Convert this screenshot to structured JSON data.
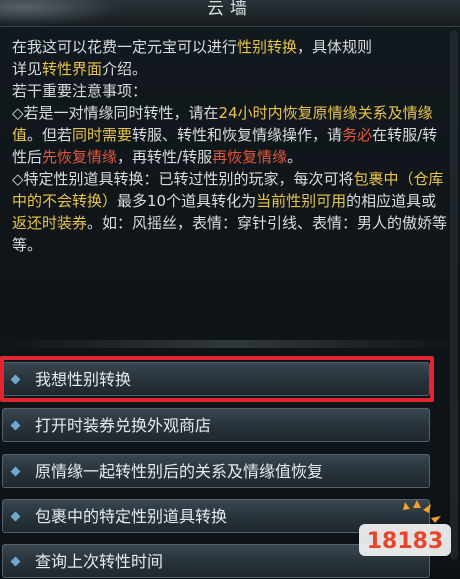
{
  "window": {
    "title": "云墙"
  },
  "content": {
    "line_intro_a": "在我这可以花费一定元宝可以进行",
    "line_intro_hl": "性别转换",
    "line_intro_b": "，具体规则",
    "line_intro2_a": "详见",
    "line_intro2_hl": "转性界面",
    "line_intro2_b": "介绍。",
    "notice_heading": "若干重要注意事项：",
    "p1_a": "◇若是一对情缘同时转性，请在",
    "p1_hl1": "24小时内恢复原情缘关系及情缘值",
    "p1_b": "。但若",
    "p1_hl2": "同时需要",
    "p1_c": "转服、转性和恢复情缘操作，请",
    "p1_hl3": "务必",
    "p1_d": "在转服/转性后",
    "p1_hl4": "先恢复情缘",
    "p1_e": "，再转性/转服",
    "p1_hl5": "再恢复情缘",
    "p1_f": "。",
    "p2_a": "◇特定性别道具转换：已转过性别的玩家，每次可将",
    "p2_hl1": "包裹中（仓库中的不会转换）",
    "p2_b": "最多10个道具转化为",
    "p2_hl2": "当前性别可用",
    "p2_c": "的相应道具或",
    "p2_hl3": "返还时装券",
    "p2_d": "。如：风摇丝，表情：穿针引线、表情：男人的傲娇等等。"
  },
  "options": [
    {
      "label": "我想性别转换"
    },
    {
      "label": "打开时装券兑换外观商店"
    },
    {
      "label": "原情缘一起转性别后的关系及情缘值恢复"
    },
    {
      "label": "包裹中的特定性别道具转换"
    },
    {
      "label": "查询上次转性时间"
    }
  ],
  "watermark": {
    "text": "18183"
  },
  "colors": {
    "highlight_yellow": "#e8c54a",
    "highlight_red": "#e0563e",
    "selection_box": "#e02632",
    "option_diamond": "#6fa8d0"
  }
}
